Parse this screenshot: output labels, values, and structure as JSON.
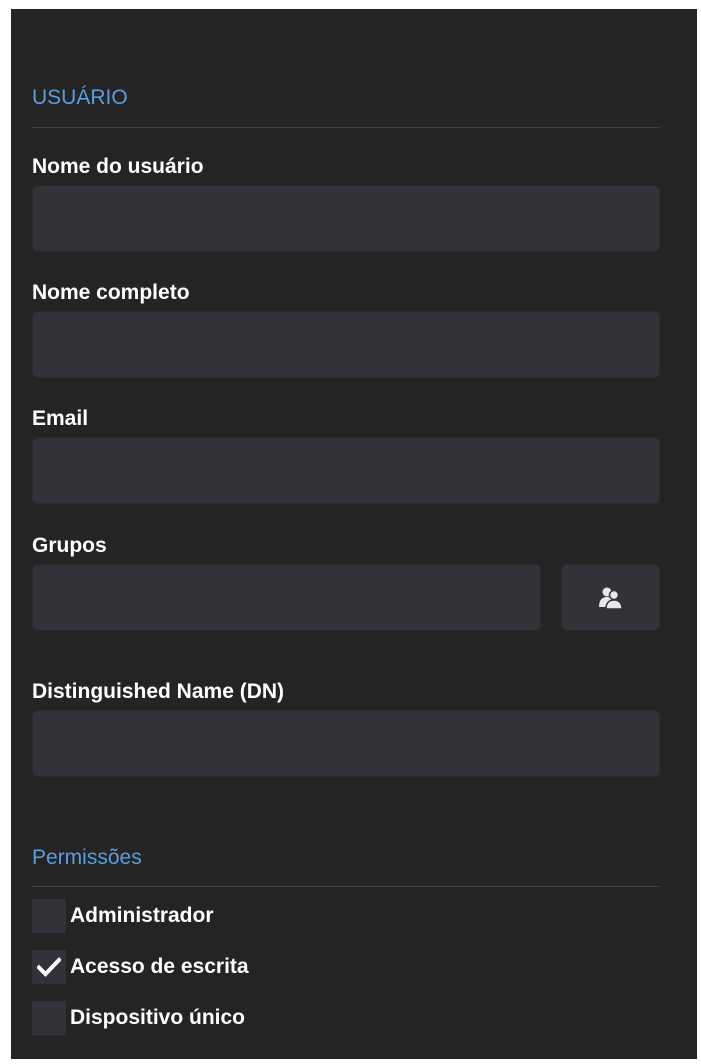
{
  "user_section": {
    "title": "USUÁRIO"
  },
  "fields": {
    "username": {
      "label": "Nome do usuário",
      "value": ""
    },
    "fullname": {
      "label": "Nome completo",
      "value": ""
    },
    "email": {
      "label": "Email",
      "value": ""
    },
    "groups": {
      "label": "Grupos",
      "value": ""
    },
    "dn": {
      "label": "Distinguished Name (DN)",
      "value": ""
    }
  },
  "groups_button": {
    "icon": "users-icon"
  },
  "permissions_section": {
    "title": "Permissões",
    "items": [
      {
        "label": "Administrador",
        "checked": false
      },
      {
        "label": "Acesso de escrita",
        "checked": true
      },
      {
        "label": "Dispositivo único",
        "checked": false
      }
    ]
  },
  "colors": {
    "panel_bg": "#242424",
    "input_bg": "#333238",
    "section_title": "#5a9ede",
    "label_text": "#ffffff"
  }
}
